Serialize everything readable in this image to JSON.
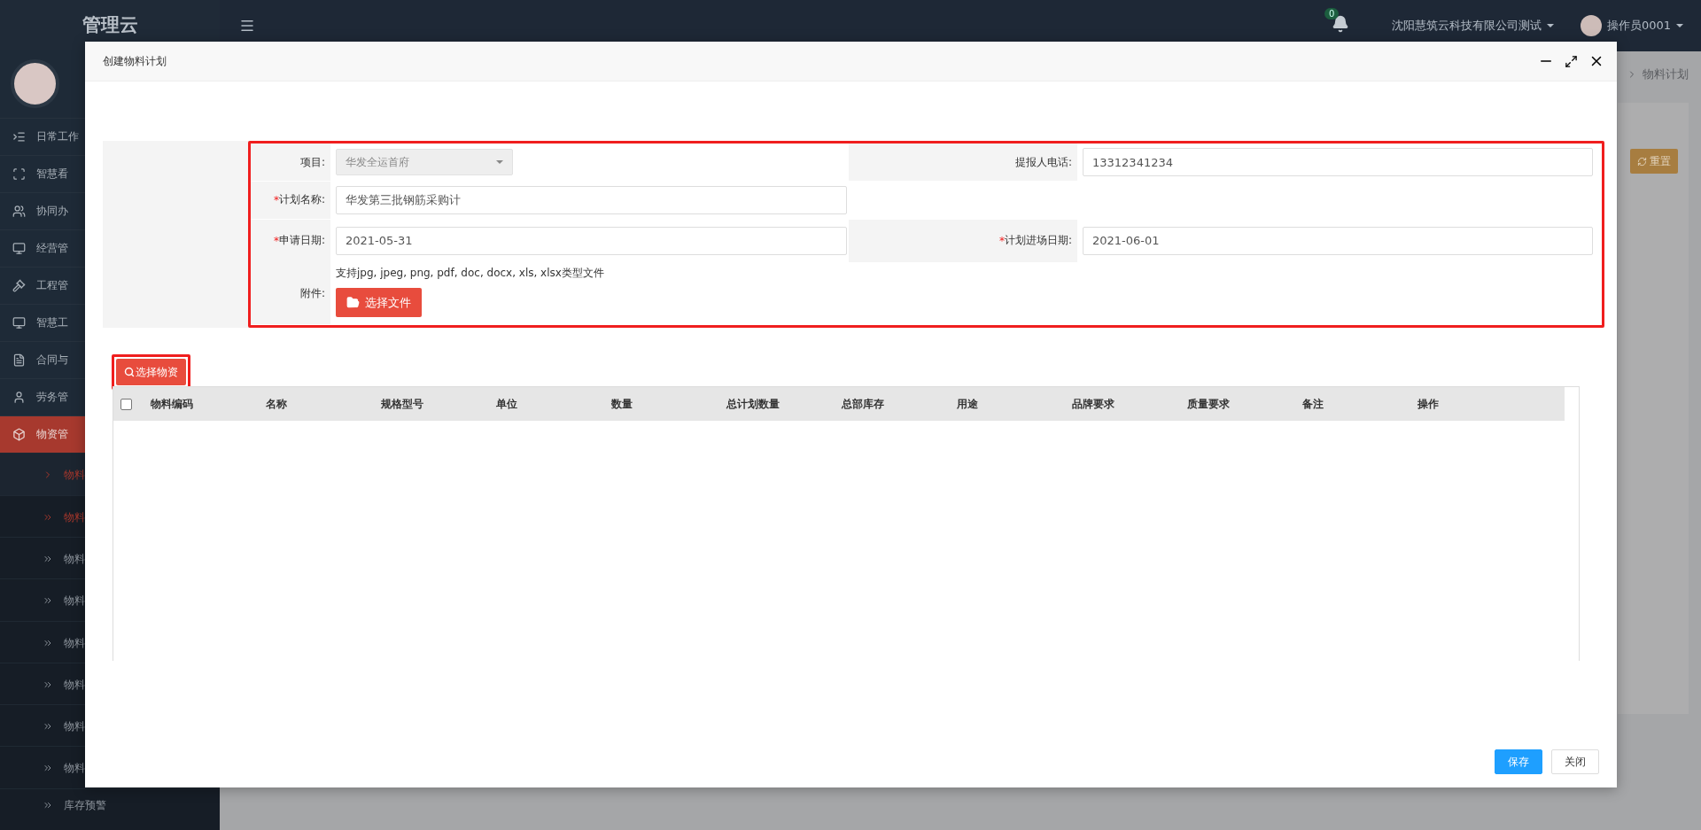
{
  "app": {
    "title": "管理云"
  },
  "topbar": {
    "notifications": "0",
    "company": "沈阳慧筑云科技有限公司测试",
    "user": "操作员0001"
  },
  "sidebar": {
    "items": [
      {
        "label": "日常工作",
        "selected": false
      },
      {
        "label": "智慧看",
        "selected": false
      },
      {
        "label": "协同办",
        "selected": false
      },
      {
        "label": "经营管",
        "selected": false
      },
      {
        "label": "工程管",
        "selected": false
      },
      {
        "label": "智慧工",
        "selected": false
      },
      {
        "label": "合同与",
        "selected": false
      },
      {
        "label": "劳务管",
        "selected": false
      },
      {
        "label": "物资管",
        "selected": true,
        "children": [
          {
            "label": "物料",
            "kind": "single",
            "active": true
          },
          {
            "label": "物料",
            "kind": "double",
            "active": true
          },
          {
            "label": "物料",
            "kind": "double",
            "active": false
          },
          {
            "label": "物料",
            "kind": "double",
            "active": false
          },
          {
            "label": "物料",
            "kind": "double",
            "active": false
          },
          {
            "label": "物料",
            "kind": "double",
            "active": false
          },
          {
            "label": "物料",
            "kind": "double",
            "active": false
          },
          {
            "label": "物料",
            "kind": "double",
            "active": false
          },
          {
            "label": "库存预警",
            "kind": "double",
            "active": false
          }
        ]
      }
    ]
  },
  "page": {
    "breadcrumb": "物料计划",
    "reset_button": "重置"
  },
  "modal": {
    "title": "创建物料计划",
    "form": {
      "rows": [
        {
          "cells": [
            {
              "label": "项目:",
              "kind": "select",
              "disabled": true,
              "value": "华发全运首府"
            },
            {
              "label": "提报人电话:",
              "kind": "input",
              "value": "13312341234"
            }
          ]
        },
        {
          "cells": [
            {
              "required_mark": "*",
              "label": "计划名称:",
              "kind": "input",
              "value": "华发第三批钢筋采购计"
            }
          ]
        },
        {
          "cells": [
            {
              "required_mark": "*",
              "label": "申请日期:",
              "kind": "input",
              "value": "2021-05-31"
            },
            {
              "required_mark": "*",
              "label": "计划进场日期:",
              "kind": "input",
              "value": "2021-06-01"
            }
          ]
        }
      ],
      "attachment": {
        "label": "附件:",
        "hint": "支持jpg, jpeg, png, pdf, doc, docx, xls, xlsx类型文件",
        "button": "选择文件"
      }
    },
    "select_button": "选择物资",
    "table": {
      "select_all": {
        "checked": false
      },
      "columns": [
        "物料编码",
        "名称",
        "规格型号",
        "单位",
        "数量",
        "总计划数量",
        "总部库存",
        "用途",
        "品牌要求",
        "质量要求",
        "备注",
        "操作"
      ]
    },
    "buttons": [
      {
        "label": "保存",
        "kind": "primary"
      },
      {
        "label": "关闭",
        "kind": "default"
      }
    ]
  }
}
